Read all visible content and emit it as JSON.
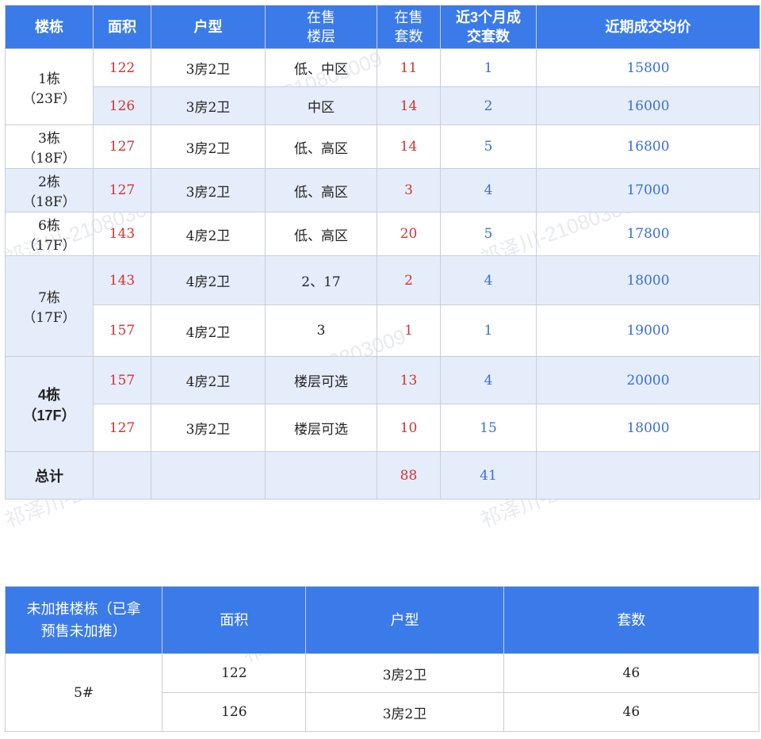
{
  "table1": {
    "headers": [
      "楼栋",
      "面积",
      "户型",
      "在售\n楼层",
      "在售\n套数",
      "近3个月成\n交套数",
      "近期成交均价"
    ],
    "rows": [
      {
        "building": "1栋\n（23F）",
        "area": "122",
        "type": "3房2卫",
        "floor": "低、中区",
        "sale": "11",
        "deals": "1",
        "price": "15800"
      },
      {
        "area": "126",
        "type": "3房2卫",
        "floor": "中区",
        "sale": "14",
        "deals": "2",
        "price": "16000"
      },
      {
        "building": "3栋\n（18F）",
        "area": "127",
        "type": "3房2卫",
        "floor": "低、高区",
        "sale": "14",
        "deals": "5",
        "price": "16800"
      },
      {
        "building": "2栋\n（18F）",
        "area": "127",
        "type": "3房2卫",
        "floor": "低、高区",
        "sale": "3",
        "deals": "4",
        "price": "17000"
      },
      {
        "building": "6栋\n（17F）",
        "area": "143",
        "type": "4房2卫",
        "floor": "低、高区",
        "sale": "20",
        "deals": "5",
        "price": "17800"
      },
      {
        "building": "7栋\n（17F）",
        "area": "143",
        "type": "4房2卫",
        "floor": "2、17",
        "sale": "2",
        "deals": "4",
        "price": "18000"
      },
      {
        "area": "157",
        "type": "4房2卫",
        "floor": "3",
        "sale": "1",
        "deals": "1",
        "price": "19000"
      },
      {
        "building": "4栋\n（17F）",
        "area": "157",
        "type": "4房2卫",
        "floor": "楼层可选",
        "sale": "13",
        "deals": "4",
        "price": "20000"
      },
      {
        "area": "127",
        "type": "3房2卫",
        "floor": "楼层可选",
        "sale": "10",
        "deals": "15",
        "price": "18000"
      }
    ],
    "total": {
      "label": "总计",
      "sale": "88",
      "deals": "41"
    }
  },
  "table2": {
    "headers": [
      "未加推楼栋（已拿\n预售未加推）",
      "面积",
      "户型",
      "套数"
    ],
    "building": "5#",
    "rows": [
      {
        "area": "122",
        "type": "3房2卫",
        "count": "46"
      },
      {
        "area": "126",
        "type": "3房2卫",
        "count": "46"
      }
    ]
  },
  "watermark": "祁泽川-210803009"
}
